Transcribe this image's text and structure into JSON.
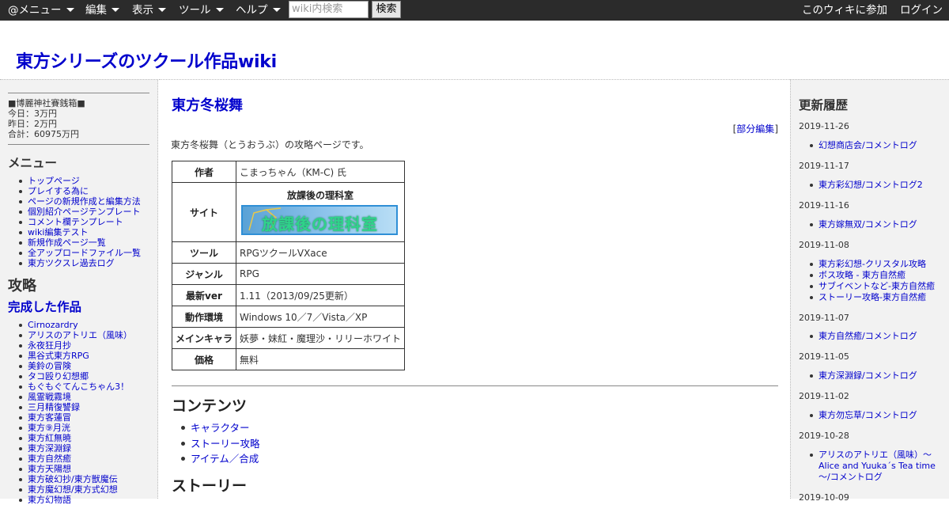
{
  "topbar": {
    "menus": [
      "@メニュー",
      "編集",
      "表示",
      "ツール",
      "ヘルプ"
    ],
    "search_placeholder": "wiki内検索",
    "search_button": "検索",
    "join": "このウィキに参加",
    "login": "ログイン"
  },
  "site_title": "東方シリーズのツクール作品wiki",
  "left": {
    "donation": [
      "■博麗神社賽銭箱■",
      "今日：3万円",
      "昨日：2万円",
      "合計：60975万円"
    ],
    "menu_heading": "メニュー",
    "menu_items": [
      "トップページ",
      "プレイする為に",
      "ページの新規作成と編集方法",
      "個別紹介ページテンプレート",
      "コメント欄テンプレート",
      "wiki編集テスト",
      "新規作成ページ一覧",
      "全アップロードファイル一覧",
      "東方ツクスレ過去ログ"
    ],
    "strategy_heading": "攻略",
    "completed_heading": "完成した作品",
    "works": [
      "Cirnozardry",
      "アリスのアトリエ（風味）",
      "永夜狂月抄",
      "黒谷式東方RPG",
      "美鈴の冒険",
      "タコ殴り幻想郷",
      "もぐもぐてんこちゃん3！",
      "風霊戦霧境",
      "三月精復讐録",
      "東方客蓮冒",
      "東方⑨月洸",
      "東方紅無暁",
      "東方深淵録",
      "東方自然癒",
      "東方天陽想",
      "東方破幻抄/東方獣魔伝",
      "東方魔幻想/東方式幻想",
      "東方幻物語"
    ]
  },
  "main": {
    "page_title": "東方冬桜舞",
    "partial_edit_open": "[",
    "partial_edit": "部分編集",
    "partial_edit_close": "]",
    "intro": "東方冬桜舞（とうおうぶ）の攻略ページです。",
    "table": {
      "author_label": "作者",
      "author": "こまっちゃん（KM-C) 氏",
      "site_label": "サイト",
      "site_name": "放課後の理科室",
      "site_banner": "放課後の理科室",
      "tool_label": "ツール",
      "tool": "RPGツクールVXace",
      "genre_label": "ジャンル",
      "genre": "RPG",
      "ver_label": "最新ver",
      "ver": "1.11（2013/09/25更新）",
      "env_label": "動作環境",
      "env": "Windows 10／7／Vista／XP",
      "chars_label": "メインキャラ",
      "chars": "妖夢・妹紅・魔理沙・リリーホワイト",
      "price_label": "価格",
      "price": "無料"
    },
    "contents_heading": "コンテンツ",
    "contents": [
      "キャラクター",
      "ストーリー攻略",
      "アイテム／合成"
    ],
    "story_heading": "ストーリー"
  },
  "right": {
    "heading": "更新履歴",
    "history": [
      {
        "date": "2019-11-26",
        "items": [
          "幻想商店会/コメントログ"
        ]
      },
      {
        "date": "2019-11-17",
        "items": [
          "東方彩幻想/コメントログ2"
        ]
      },
      {
        "date": "2019-11-16",
        "items": [
          "東方嫁無双/コメントログ"
        ]
      },
      {
        "date": "2019-11-08",
        "items": [
          "東方彩幻想-クリスタル攻略",
          "ボス攻略 - 東方自然癒",
          "サブイベントなど-東方自然癒",
          "ストーリー攻略-東方自然癒"
        ]
      },
      {
        "date": "2019-11-07",
        "items": [
          "東方自然癒/コメントログ"
        ]
      },
      {
        "date": "2019-11-05",
        "items": [
          "東方深淵録/コメントログ"
        ]
      },
      {
        "date": "2019-11-02",
        "items": [
          "東方勿忘草/コメントログ"
        ]
      },
      {
        "date": "2019-10-28",
        "items": [
          "アリスのアトリエ（風味）～Alice and Yuuka´s Tea time～/コメントログ"
        ]
      },
      {
        "date": "2019-10-09",
        "items": []
      }
    ]
  }
}
